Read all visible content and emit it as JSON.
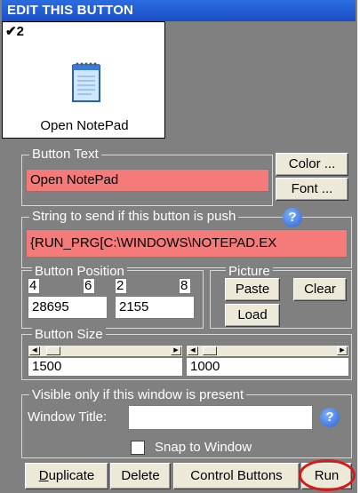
{
  "window": {
    "title": "EDIT THIS BUTTON"
  },
  "preview": {
    "check": "✔2",
    "label": "Open NotePad",
    "icon": "notepad-icon"
  },
  "button_text": {
    "legend": "Button Text",
    "value": "Open NotePad",
    "color_label": "Color ...",
    "font_label": "Font ..."
  },
  "send_string": {
    "legend": "String to send if this button is push",
    "value": "{RUN_PRG[C:\\WINDOWS\\NOTEPAD.EX"
  },
  "position": {
    "legend": "Button Position",
    "n1": "4",
    "n2": "6",
    "n3": "2",
    "n4": "8",
    "x": "28695",
    "y": "2155"
  },
  "picture": {
    "legend": "Picture",
    "paste_label": "Paste",
    "clear_label": "Clear",
    "load_label": "Load"
  },
  "size": {
    "legend": "Button Size",
    "width": "1500",
    "height": "1000"
  },
  "visibility": {
    "legend": "Visible only if this window is present",
    "window_title_label": "Window Title:",
    "window_title_value": "",
    "snap_label": "Snap to Window",
    "snap_checked": false
  },
  "actions": {
    "duplicate_label": "Duplicate",
    "delete_label": "Delete",
    "control_label": "Control Buttons",
    "run_label": "Run"
  },
  "colors": {
    "title_bar": "#1a4fc7",
    "panel": "#808080",
    "highlight_input": "#f57a7a",
    "run_annotation": "#d81818"
  }
}
